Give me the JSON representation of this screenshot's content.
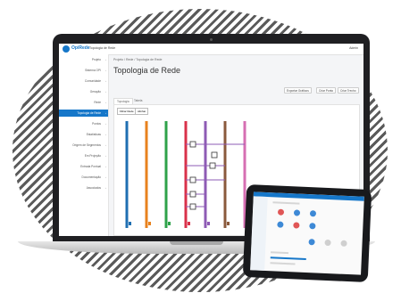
{
  "app": {
    "logo_text": "OpiRede",
    "project": "Topologia de Rede",
    "user": "Admin"
  },
  "sidebar": {
    "items": [
      {
        "label": "Projeto",
        "active": false
      },
      {
        "label": "Sistema OPI",
        "active": false
      },
      {
        "label": "Comunidade",
        "active": false
      },
      {
        "label": "Geração",
        "active": false
      },
      {
        "label": "Rede",
        "active": false
      },
      {
        "label": "Topologia de Rede",
        "active": true
      },
      {
        "label": "Pontos",
        "active": false
      },
      {
        "label": "Estatísticas",
        "active": false
      },
      {
        "label": "Origem de Segmentos",
        "active": false
      },
      {
        "label": "Em Projeção",
        "active": false
      },
      {
        "label": "Entrada Pontual",
        "active": false
      },
      {
        "label": "Documentação",
        "active": false
      },
      {
        "label": "Associados",
        "active": false
      }
    ]
  },
  "main": {
    "breadcrumb": "Projeto / Rede / Topologia de Rede",
    "title": "Topologia de Rede",
    "buttons": {
      "export": "Exportar Gráficos",
      "new_point": "Criar Ponto",
      "new_segment": "Criar Trecho"
    },
    "tabs": [
      "Topologia",
      "Tabela"
    ],
    "chips": [
      "Filtrar Rede",
      "Alinhar"
    ]
  },
  "colors": {
    "accent": "#1677c9",
    "lines": [
      "#1f6fb2",
      "#e8821e",
      "#2ea24a",
      "#d9314a",
      "#8e5bb5",
      "#8a5a3c",
      "#d66fb3"
    ]
  }
}
